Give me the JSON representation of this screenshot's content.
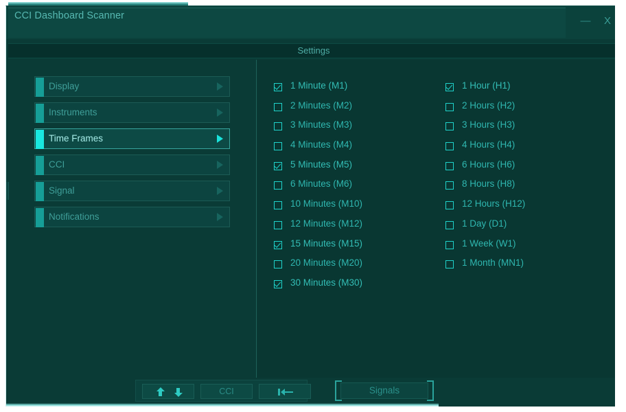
{
  "window": {
    "title": "CCI Dashboard Scanner",
    "minimize_label": "—",
    "close_label": "X",
    "minimize_icon": "minimize-icon",
    "close_icon": "close-icon"
  },
  "header": {
    "title": "Settings"
  },
  "colors": {
    "window_bg": "#0a3b36",
    "content_bg": "#093732",
    "titlebar_bg": "#0d4842",
    "header_bar_bg": "#06302c",
    "accent_dim": "#169e97",
    "accent_bright": "#19e8e0",
    "text_dim": "#3f9f99",
    "text_bright": "#a6ece8",
    "checkbox_border": "#1fd3cb",
    "checkbox_label": "#2fb7b0"
  },
  "sidebar": {
    "items": [
      {
        "label": "Display",
        "active": false,
        "arrow_icon": "chevron-right-icon"
      },
      {
        "label": "Instruments",
        "active": false,
        "arrow_icon": "chevron-right-icon"
      },
      {
        "label": "Time Frames",
        "active": true,
        "arrow_icon": "chevron-right-icon"
      },
      {
        "label": "CCI",
        "active": false,
        "arrow_icon": "chevron-right-icon"
      },
      {
        "label": "Signal",
        "active": false,
        "arrow_icon": "chevron-right-icon"
      },
      {
        "label": "Notifications",
        "active": false,
        "arrow_icon": "chevron-right-icon"
      }
    ]
  },
  "timeframes": {
    "column_minutes": [
      {
        "label": "1 Minute (M1)",
        "code": "M1",
        "checked": true
      },
      {
        "label": "2 Minutes (M2)",
        "code": "M2",
        "checked": false
      },
      {
        "label": "3 Minutes (M3)",
        "code": "M3",
        "checked": false
      },
      {
        "label": "4 Minutes (M4)",
        "code": "M4",
        "checked": false
      },
      {
        "label": "5 Minutes (M5)",
        "code": "M5",
        "checked": true
      },
      {
        "label": "6 Minutes (M6)",
        "code": "M6",
        "checked": false
      },
      {
        "label": "10 Minutes (M10)",
        "code": "M10",
        "checked": false
      },
      {
        "label": "12 Minutes (M12)",
        "code": "M12",
        "checked": false
      },
      {
        "label": "15 Minutes (M15)",
        "code": "M15",
        "checked": true
      },
      {
        "label": "20 Minutes (M20)",
        "code": "M20",
        "checked": false
      },
      {
        "label": "30 Minutes (M30)",
        "code": "M30",
        "checked": true
      }
    ],
    "column_hours": [
      {
        "label": "1 Hour (H1)",
        "code": "H1",
        "checked": true
      },
      {
        "label": "2 Hours (H2)",
        "code": "H2",
        "checked": false
      },
      {
        "label": "3 Hours (H3)",
        "code": "H3",
        "checked": false
      },
      {
        "label": "4 Hours (H4)",
        "code": "H4",
        "checked": false
      },
      {
        "label": "6 Hours (H6)",
        "code": "H6",
        "checked": false
      },
      {
        "label": "8 Hours (H8)",
        "code": "H8",
        "checked": false
      },
      {
        "label": "12 Hours (H12)",
        "code": "H12",
        "checked": false
      },
      {
        "label": "1 Day (D1)",
        "code": "D1",
        "checked": false
      },
      {
        "label": "1 Week (W1)",
        "code": "W1",
        "checked": false
      },
      {
        "label": "1 Month (MN1)",
        "code": "MN1",
        "checked": false
      }
    ]
  },
  "footer": {
    "sort_button": {
      "label": "",
      "up_icon": "arrow-up-icon",
      "down_icon": "arrow-down-icon"
    },
    "cci_button": {
      "label": "CCI"
    },
    "collapse_button": {
      "label": "",
      "icon": "collapse-left-icon"
    },
    "signals_button": {
      "label": "Signals"
    }
  }
}
